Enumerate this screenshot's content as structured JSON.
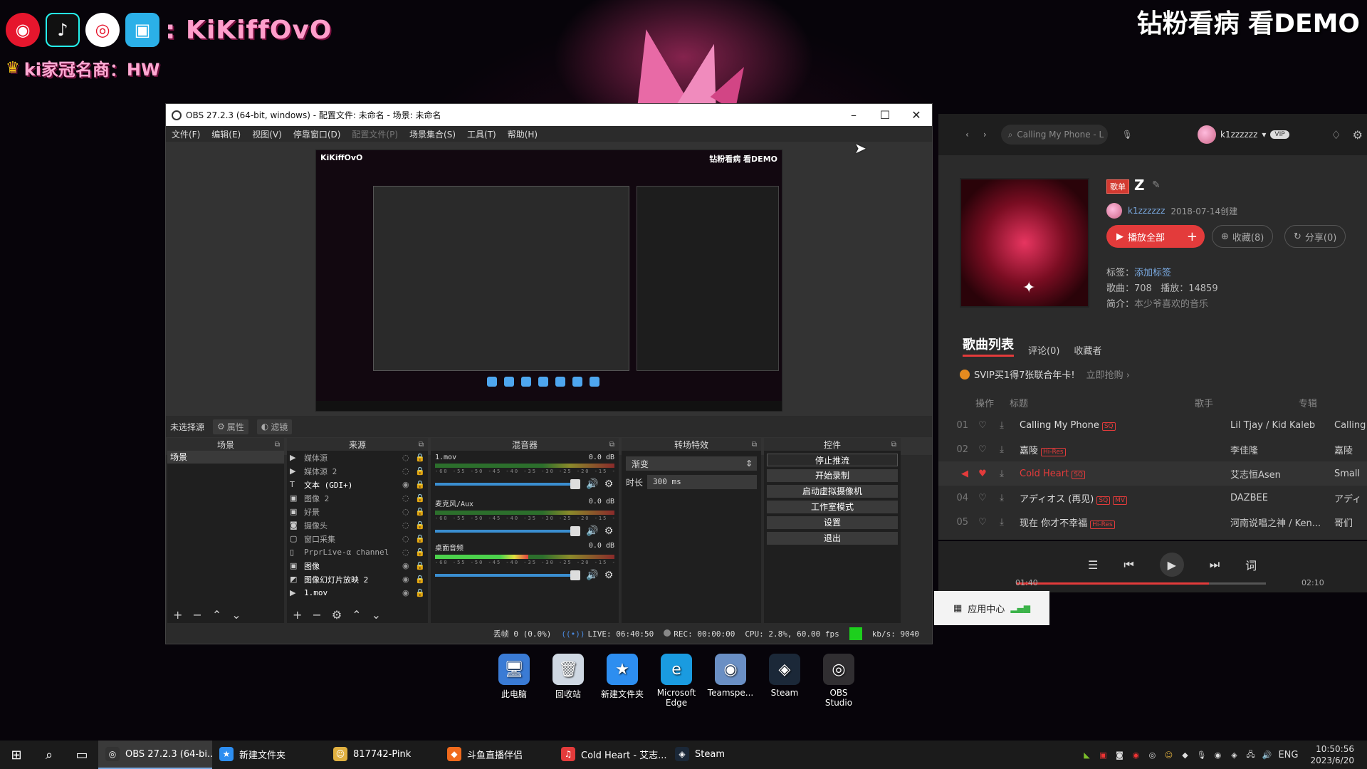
{
  "overlay": {
    "streamer_name": ": KiKiffOvO",
    "crown_text": "ki家冠名商：HW",
    "top_right": "钻粉看病 看DEMO"
  },
  "obs": {
    "title": "OBS 27.2.3 (64-bit, windows) - 配置文件: 未命名 - 场景: 未命名",
    "menu": [
      "文件(F)",
      "编辑(E)",
      "视图(V)",
      "停靠窗口(D)",
      "配置文件(P)",
      "场景集合(S)",
      "工具(T)",
      "帮助(H)"
    ],
    "source_bar": {
      "no_source": "未选择源",
      "properties": "属性",
      "filters": "滤镜"
    },
    "docks": {
      "scenes": {
        "title": "场景",
        "items": [
          "场景"
        ]
      },
      "sources": {
        "title": "来源",
        "items": [
          {
            "name": "媒体源",
            "icon": "▶",
            "visible": false
          },
          {
            "name": "媒体源 2",
            "icon": "▶",
            "visible": false
          },
          {
            "name": "文本 (GDI+)",
            "icon": "T",
            "visible": true
          },
          {
            "name": "图像 2",
            "icon": "▣",
            "visible": false
          },
          {
            "name": "好景",
            "icon": "▣",
            "visible": false
          },
          {
            "name": "摄像头",
            "icon": "◙",
            "visible": false
          },
          {
            "name": "窗口采集",
            "icon": "▢",
            "visible": false
          },
          {
            "name": "PrprLive-α channel",
            "icon": "▯",
            "visible": false
          },
          {
            "name": "图像",
            "icon": "▣",
            "visible": true
          },
          {
            "name": "图像幻灯片放映 2",
            "icon": "◩",
            "visible": true
          },
          {
            "name": "1.mov",
            "icon": "▶",
            "visible": true
          }
        ]
      },
      "mixer": {
        "title": "混音器",
        "channels": [
          {
            "name": "1.mov",
            "db": "0.0 dB",
            "level": 0.0
          },
          {
            "name": "麦克风/Aux",
            "db": "0.0 dB",
            "level": 0.0
          },
          {
            "name": "桌面音频",
            "db": "0.0 dB",
            "level": 0.52
          }
        ],
        "scale": "-60 -55 -50 -45 -40 -35 -30 -25 -20 -15 -10 -5 0"
      },
      "transitions": {
        "title": "转场特效",
        "selected": "渐变",
        "duration_label": "时长",
        "duration_value": "300 ms"
      },
      "controls": {
        "title": "控件",
        "buttons": [
          "停止推流",
          "开始录制",
          "启动虚拟摄像机",
          "工作室模式",
          "设置",
          "退出"
        ]
      }
    },
    "status": {
      "dropped": "丢帧 0 (0.0%)",
      "live": "LIVE: 06:40:50",
      "rec": "REC: 00:00:00",
      "cpu": "CPU: 2.8%, 60.00 fps",
      "kbs": "kb/s: 9040"
    },
    "preview": {
      "label_left": "KiKiffOvO",
      "label_right": "钻粉看病 看DEMO"
    }
  },
  "music": {
    "search_placeholder": "Calling My Phone - L",
    "username": "k1zzzzzz",
    "vip": "VIP",
    "playlist": {
      "tag": "歌单",
      "name": "Z",
      "creator": "k1zzzzzz",
      "created": "2018-07-14创建",
      "play_all": "播放全部",
      "collect": "收藏(8)",
      "share": "分享(0)",
      "tag_label": "标签：",
      "tag_value": "添加标签",
      "songs_label": "歌曲：708",
      "plays_label": "播放：14859",
      "intro_label": "简介：",
      "intro_value": "本少爷喜欢的音乐"
    },
    "tabs": [
      "歌曲列表",
      "评论(0)",
      "收藏者"
    ],
    "svip_text": "SVIP买1得7张联合年卡!",
    "svip_buy": "立即抢购 ›",
    "columns": {
      "ops": "操作",
      "title": "标题",
      "artist": "歌手",
      "album": "专辑"
    },
    "songs": [
      {
        "idx": "01",
        "title": "Calling My Phone",
        "badges": [
          "SQ"
        ],
        "artist": "Lil Tjay / Kid Kaleb",
        "album": "Calling",
        "playing": false
      },
      {
        "idx": "02",
        "title": "嘉陵",
        "badges": [
          "Hi-Res"
        ],
        "artist": "李佳隆",
        "album": "嘉陵",
        "playing": false
      },
      {
        "idx": "",
        "title": "Cold Heart",
        "badges": [
          "SQ"
        ],
        "artist": "艾志恒Asen",
        "album": "Small",
        "playing": true
      },
      {
        "idx": "04",
        "title": "アディオス (再见)",
        "badges": [
          "SQ",
          "MV"
        ],
        "artist": "DAZBEE",
        "album": "アディ",
        "playing": false
      },
      {
        "idx": "05",
        "title": "现在 你才不幸福",
        "badges": [
          "Hi-Res"
        ],
        "artist": "河南说唱之神 / Ken...",
        "album": "哥们",
        "playing": false
      }
    ],
    "player": {
      "time_current": "01:40",
      "time_total": "02:10",
      "progress": 0.77,
      "lyric_btn": "词"
    }
  },
  "app_center": "应用中心",
  "desktop_icons": [
    {
      "label": "此电脑",
      "icon": "🖥",
      "color": "#3a7bd5"
    },
    {
      "label": "回收站",
      "icon": "🗑",
      "color": "#cfd8e3"
    },
    {
      "label": "新建文件夹",
      "icon": "★",
      "color": "#2d8ef0"
    },
    {
      "label": "Microsoft Edge",
      "icon": "e",
      "color": "#1a9be0"
    },
    {
      "label": "Teamspe...",
      "icon": "◉",
      "color": "#6a8fc4"
    },
    {
      "label": "Steam",
      "icon": "◈",
      "color": "#1b2838"
    },
    {
      "label": "OBS Studio",
      "icon": "◎",
      "color": "#302e31"
    }
  ],
  "taskbar": {
    "apps": [
      {
        "label": "OBS 27.2.3 (64-bi...",
        "icon": "◎",
        "color": "#333",
        "active": true
      },
      {
        "label": "新建文件夹",
        "icon": "★",
        "color": "#2d8ef0",
        "active": false
      },
      {
        "label": "817742-Pink",
        "icon": "☺",
        "color": "#e0b040",
        "active": false
      },
      {
        "label": "斗鱼直播伴侣",
        "icon": "◆",
        "color": "#f06a1c",
        "active": false
      },
      {
        "label": "Cold Heart - 艾志...",
        "icon": "♫",
        "color": "#e33b3b",
        "active": false
      },
      {
        "label": "Steam",
        "icon": "◈",
        "color": "#1b2838",
        "active": false
      }
    ],
    "lang": "ENG",
    "time": "10:50:56",
    "date": "2023/6/20"
  }
}
